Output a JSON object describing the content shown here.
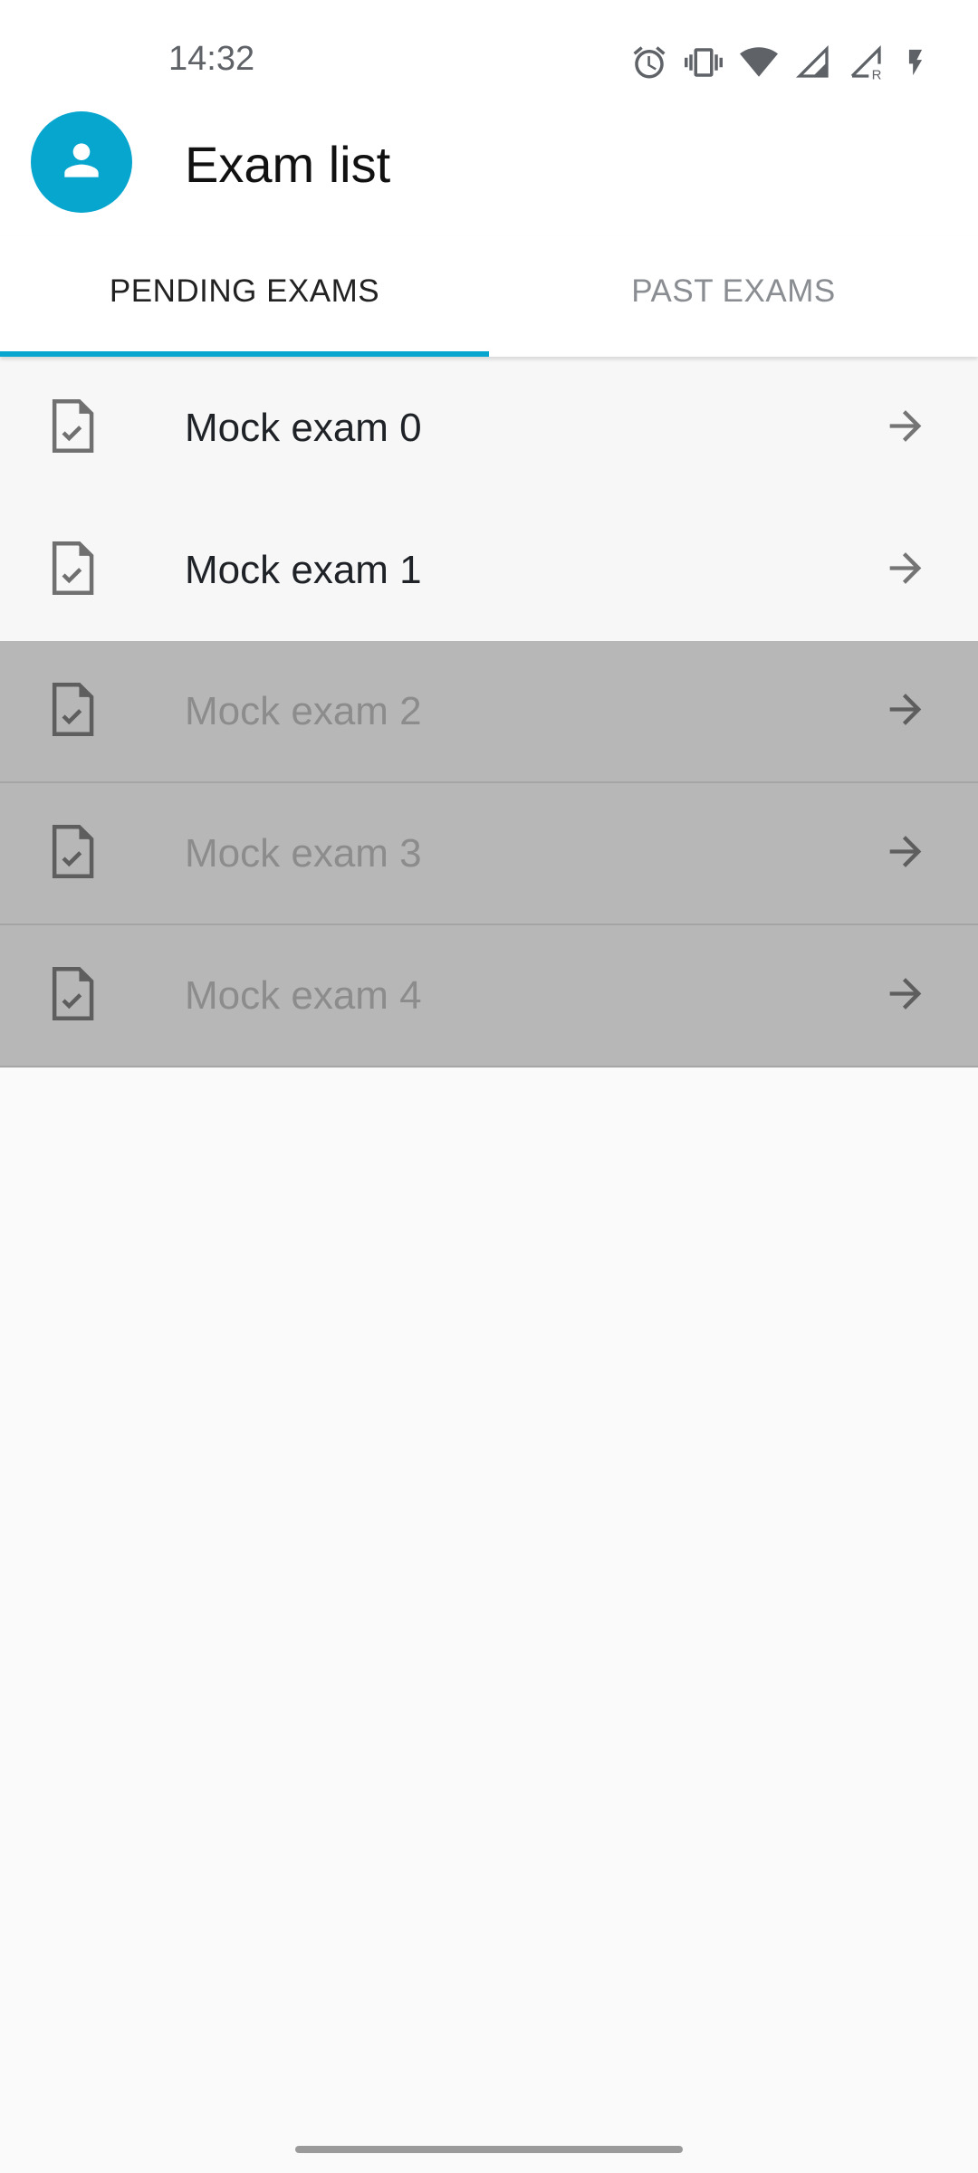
{
  "status_bar": {
    "time": "14:32",
    "icons": [
      "alarm-icon",
      "vibrate-icon",
      "wifi-icon",
      "signal-icon",
      "signal-roaming-icon",
      "charging-icon"
    ]
  },
  "header": {
    "title": "Exam list",
    "avatar_icon": "person-icon",
    "accent_color": "#07a6cf"
  },
  "tabs": [
    {
      "label": "PENDING EXAMS",
      "active": true
    },
    {
      "label": "PAST EXAMS",
      "active": false
    }
  ],
  "exams": [
    {
      "label": "Mock exam 0",
      "enabled": true
    },
    {
      "label": "Mock exam 1",
      "enabled": true
    },
    {
      "label": "Mock exam 2",
      "enabled": false
    },
    {
      "label": "Mock exam 3",
      "enabled": false
    },
    {
      "label": "Mock exam 4",
      "enabled": false
    }
  ]
}
